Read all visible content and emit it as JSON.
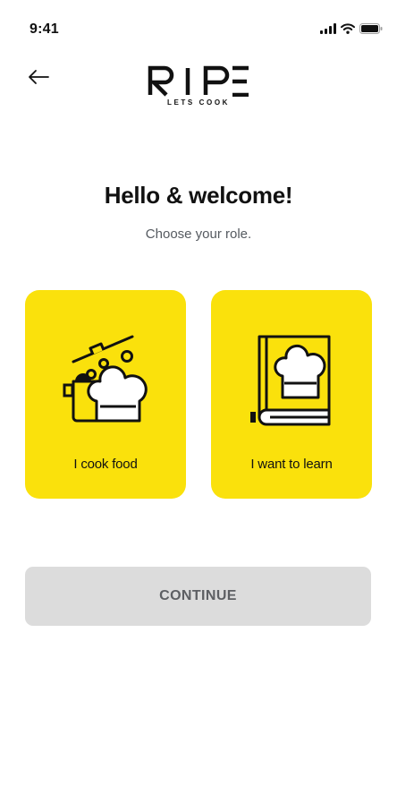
{
  "status_bar": {
    "time": "9:41",
    "icons": [
      "cellular-signal-icon",
      "wifi-icon",
      "battery-icon"
    ]
  },
  "header": {
    "back_icon": "arrow-left-icon",
    "logo_text": "RIPE",
    "logo_tagline": "LETS COOK"
  },
  "main": {
    "title": "Hello & welcome!",
    "subtitle": "Choose your role.",
    "roles": [
      {
        "label": "I cook food",
        "icon": "cooking-pot-chef-hat-icon"
      },
      {
        "label": "I want to learn",
        "icon": "cookbook-icon"
      }
    ],
    "continue_label": "CONTINUE"
  },
  "colors": {
    "card_background": "#fae10c",
    "button_background": "#dcdcdc",
    "button_text": "#5d5f63",
    "subtitle_text": "#555a60"
  }
}
